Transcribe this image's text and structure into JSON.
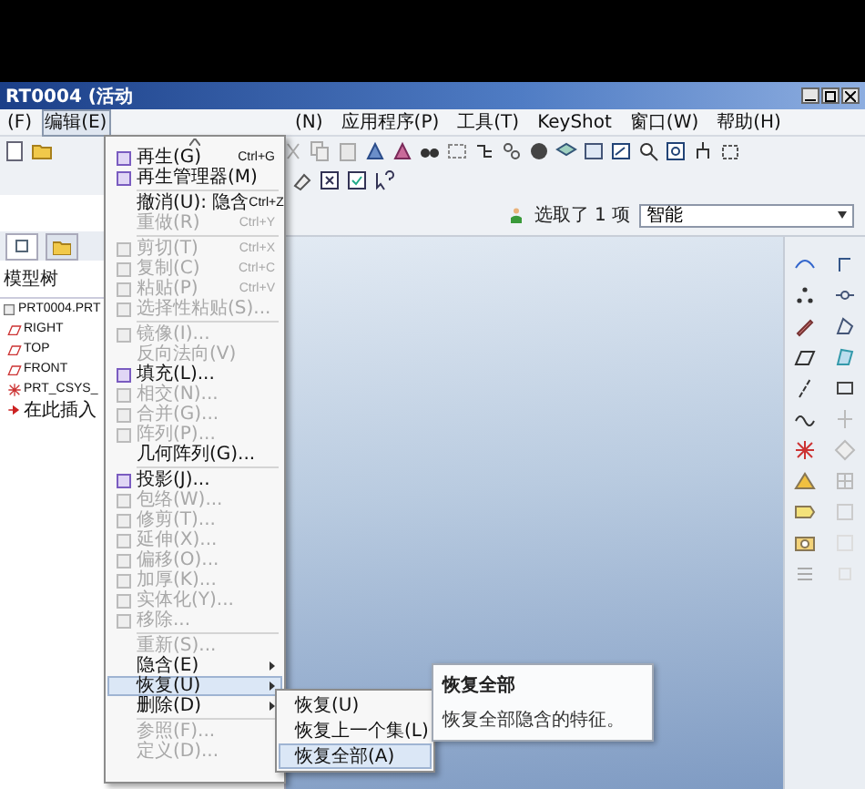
{
  "window": {
    "title": "RT0004 (活动"
  },
  "menu_bar": {
    "left": [
      {
        "label": "(F)",
        "selected": false
      },
      {
        "label": "编辑(E)",
        "selected": true
      }
    ],
    "right": [
      {
        "label": "(N)",
        "selected": false
      },
      {
        "label": "应用程序(P)",
        "selected": false
      },
      {
        "label": "工具(T)",
        "selected": false
      },
      {
        "label": "KeyShot",
        "selected": false
      },
      {
        "label": "窗口(W)",
        "selected": false
      },
      {
        "label": "帮助(H)",
        "selected": false
      }
    ]
  },
  "model_tree": {
    "title": "模型树",
    "items": [
      {
        "label": "PRT0004.PRT",
        "kind": "part",
        "children": [
          {
            "label": "RIGHT",
            "kind": "plane"
          },
          {
            "label": "TOP",
            "kind": "plane"
          },
          {
            "label": "FRONT",
            "kind": "plane"
          },
          {
            "label": "PRT_CSYS_",
            "kind": "csys"
          },
          {
            "label": "在此插入",
            "kind": "insert"
          }
        ]
      }
    ]
  },
  "status": {
    "selection": "选取了 1 项",
    "filter": "智能"
  },
  "edit_menu": [
    {
      "kind": "item",
      "label": "再生(G)",
      "shortcut": "Ctrl+G",
      "disabled": false,
      "icon": true,
      "selected": false
    },
    {
      "kind": "item",
      "label": "再生管理器(M)",
      "disabled": false,
      "icon": true,
      "selected": false
    },
    {
      "kind": "separator"
    },
    {
      "kind": "item",
      "label": "撤消(U): 隐含",
      "shortcut": "Ctrl+Z",
      "disabled": false,
      "icon": false,
      "selected": false
    },
    {
      "kind": "item",
      "label": "重做(R)",
      "shortcut": "Ctrl+Y",
      "disabled": true,
      "icon": false,
      "selected": false
    },
    {
      "kind": "separator"
    },
    {
      "kind": "item",
      "label": "剪切(T)",
      "shortcut": "Ctrl+X",
      "disabled": true,
      "icon": true,
      "selected": false
    },
    {
      "kind": "item",
      "label": "复制(C)",
      "shortcut": "Ctrl+C",
      "disabled": true,
      "icon": true,
      "selected": false
    },
    {
      "kind": "item",
      "label": "粘贴(P)",
      "shortcut": "Ctrl+V",
      "disabled": true,
      "icon": true,
      "selected": false
    },
    {
      "kind": "item",
      "label": "选择性粘贴(S)...",
      "disabled": true,
      "icon": true,
      "selected": false
    },
    {
      "kind": "separator"
    },
    {
      "kind": "item",
      "label": "镜像(I)...",
      "disabled": true,
      "icon": true,
      "selected": false
    },
    {
      "kind": "item",
      "label": "反向法向(V)",
      "disabled": true,
      "icon": false,
      "selected": false
    },
    {
      "kind": "item",
      "label": "填充(L)...",
      "disabled": false,
      "icon": true,
      "selected": false
    },
    {
      "kind": "item",
      "label": "相交(N)...",
      "disabled": true,
      "icon": true,
      "selected": false
    },
    {
      "kind": "item",
      "label": "合并(G)...",
      "disabled": true,
      "icon": true,
      "selected": false
    },
    {
      "kind": "item",
      "label": "阵列(P)...",
      "disabled": true,
      "icon": true,
      "selected": false
    },
    {
      "kind": "item",
      "label": "几何阵列(G)...",
      "disabled": false,
      "icon": false,
      "selected": false
    },
    {
      "kind": "separator"
    },
    {
      "kind": "item",
      "label": "投影(J)...",
      "disabled": false,
      "icon": true,
      "selected": false
    },
    {
      "kind": "item",
      "label": "包络(W)...",
      "disabled": true,
      "icon": true,
      "selected": false
    },
    {
      "kind": "item",
      "label": "修剪(T)...",
      "disabled": true,
      "icon": true,
      "selected": false
    },
    {
      "kind": "item",
      "label": "延伸(X)...",
      "disabled": true,
      "icon": true,
      "selected": false
    },
    {
      "kind": "item",
      "label": "偏移(O)...",
      "disabled": true,
      "icon": true,
      "selected": false
    },
    {
      "kind": "item",
      "label": "加厚(K)...",
      "disabled": true,
      "icon": true,
      "selected": false
    },
    {
      "kind": "item",
      "label": "实体化(Y)...",
      "disabled": true,
      "icon": true,
      "selected": false
    },
    {
      "kind": "item",
      "label": "移除...",
      "disabled": true,
      "icon": true,
      "selected": false
    },
    {
      "kind": "separator"
    },
    {
      "kind": "item",
      "label": "重新(S)...",
      "disabled": true,
      "icon": false,
      "selected": false
    },
    {
      "kind": "submenu",
      "label": "隐含(E)",
      "disabled": false,
      "icon": false,
      "selected": false
    },
    {
      "kind": "submenu",
      "label": "恢复(U)",
      "disabled": false,
      "icon": false,
      "selected": true
    },
    {
      "kind": "submenu",
      "label": "删除(D)",
      "disabled": false,
      "icon": false,
      "selected": false
    },
    {
      "kind": "separator"
    },
    {
      "kind": "item",
      "label": "参照(F)...",
      "disabled": true,
      "icon": false,
      "selected": false
    },
    {
      "kind": "item",
      "label": "定义(D)...",
      "disabled": true,
      "icon": false,
      "selected": false
    }
  ],
  "resume_submenu": [
    {
      "label": "恢复(U)",
      "selected": false
    },
    {
      "label": "恢复上一个集(L)",
      "selected": false
    },
    {
      "label": "恢复全部(A)",
      "selected": true
    }
  ],
  "tooltip": {
    "title": "恢复全部",
    "text": "恢复全部隐含的特征。"
  }
}
